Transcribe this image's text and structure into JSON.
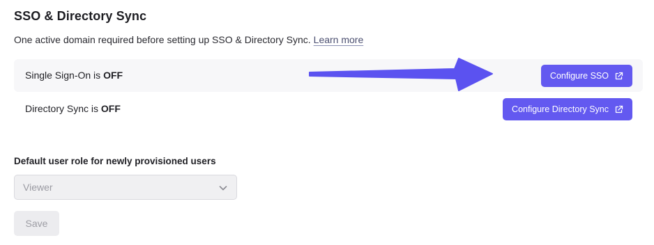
{
  "section": {
    "title": "SSO & Directory Sync",
    "description": "One active domain required before setting up SSO & Directory Sync.",
    "learn_more": "Learn more"
  },
  "sso": {
    "label_prefix": "Single Sign-On is ",
    "status": "OFF",
    "button_label": "Configure SSO",
    "button_icon": "external-link-icon"
  },
  "directory_sync": {
    "label_prefix": "Directory Sync is ",
    "status": "OFF",
    "button_label": "Configure Directory Sync",
    "button_icon": "external-link-icon"
  },
  "default_role": {
    "label": "Default user role for newly provisioned users",
    "selected": "Viewer",
    "icon": "chevron-down-icon"
  },
  "save_label": "Save",
  "colors": {
    "primary": "#6359f0",
    "arrow": "#5b52f0",
    "highlight_row": "#f7f7f9"
  }
}
